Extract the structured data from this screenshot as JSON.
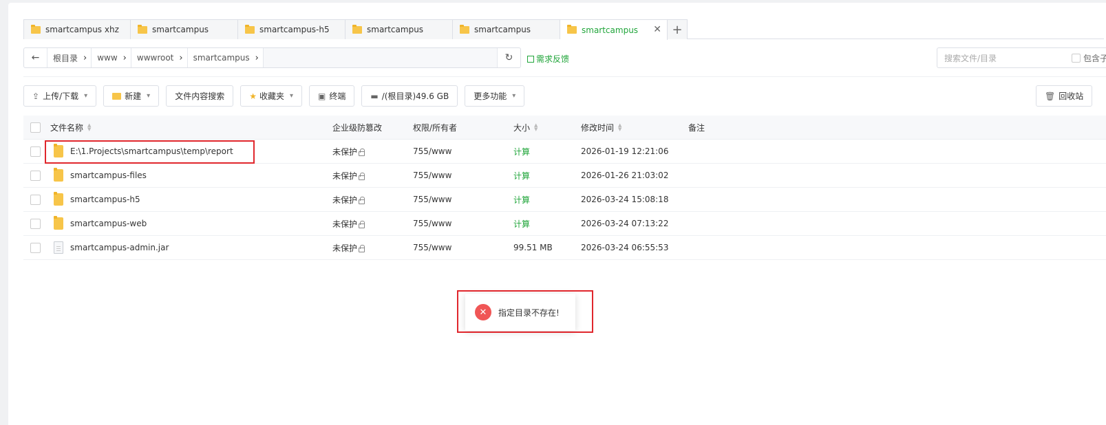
{
  "tabs": [
    {
      "label": "smartcampus xhz",
      "active": false
    },
    {
      "label": "smartcampus",
      "active": false
    },
    {
      "label": "smartcampus-h5",
      "active": false
    },
    {
      "label": "smartcampus",
      "active": false
    },
    {
      "label": "smartcampus",
      "active": false
    },
    {
      "label": "smartcampus",
      "active": true
    }
  ],
  "tab_close": "✕",
  "tab_add": "+",
  "breadcrumb": [
    "根目录",
    "www",
    "wwwroot",
    "smartcampus"
  ],
  "feedback_label": "需求反馈",
  "search": {
    "placeholder": "搜索文件/目录",
    "include_label": "包含子"
  },
  "toolbar": {
    "upload": "上传/下载",
    "new": "新建",
    "content_search": "文件内容搜索",
    "favorites": "收藏夹",
    "terminal": "终端",
    "disk": "/(根目录)49.6 GB",
    "more": "更多功能",
    "recycle": "回收站"
  },
  "columns": {
    "name": "文件名称",
    "protect": "企业级防篡改",
    "perm": "权限/所有者",
    "size": "大小",
    "mtime": "修改时间",
    "note": "备注"
  },
  "rows": [
    {
      "name": "E:\\1.Projects\\smartcampus\\temp\\report",
      "type": "folder",
      "protect": "未保护",
      "perm": "755/www",
      "size": "计算",
      "mtime": "2026-01-19 12:21:06"
    },
    {
      "name": "smartcampus-files",
      "type": "folder",
      "protect": "未保护",
      "perm": "755/www",
      "size": "计算",
      "mtime": "2026-01-26 21:03:02"
    },
    {
      "name": "smartcampus-h5",
      "type": "folder",
      "protect": "未保护",
      "perm": "755/www",
      "size": "计算",
      "mtime": "2026-03-24 15:08:18"
    },
    {
      "name": "smartcampus-web",
      "type": "folder",
      "protect": "未保护",
      "perm": "755/www",
      "size": "计算",
      "mtime": "2026-03-24 07:13:22"
    },
    {
      "name": "smartcampus-admin.jar",
      "type": "file",
      "protect": "未保护",
      "perm": "755/www",
      "size": "99.51 MB",
      "mtime": "2026-03-24 06:55:53"
    }
  ],
  "toast": {
    "icon": "✕",
    "message": "指定目录不存在!"
  },
  "colors": {
    "accent": "#20a53a",
    "error": "#f05656",
    "highlight": "#e0262c",
    "folder": "#f7c549"
  }
}
